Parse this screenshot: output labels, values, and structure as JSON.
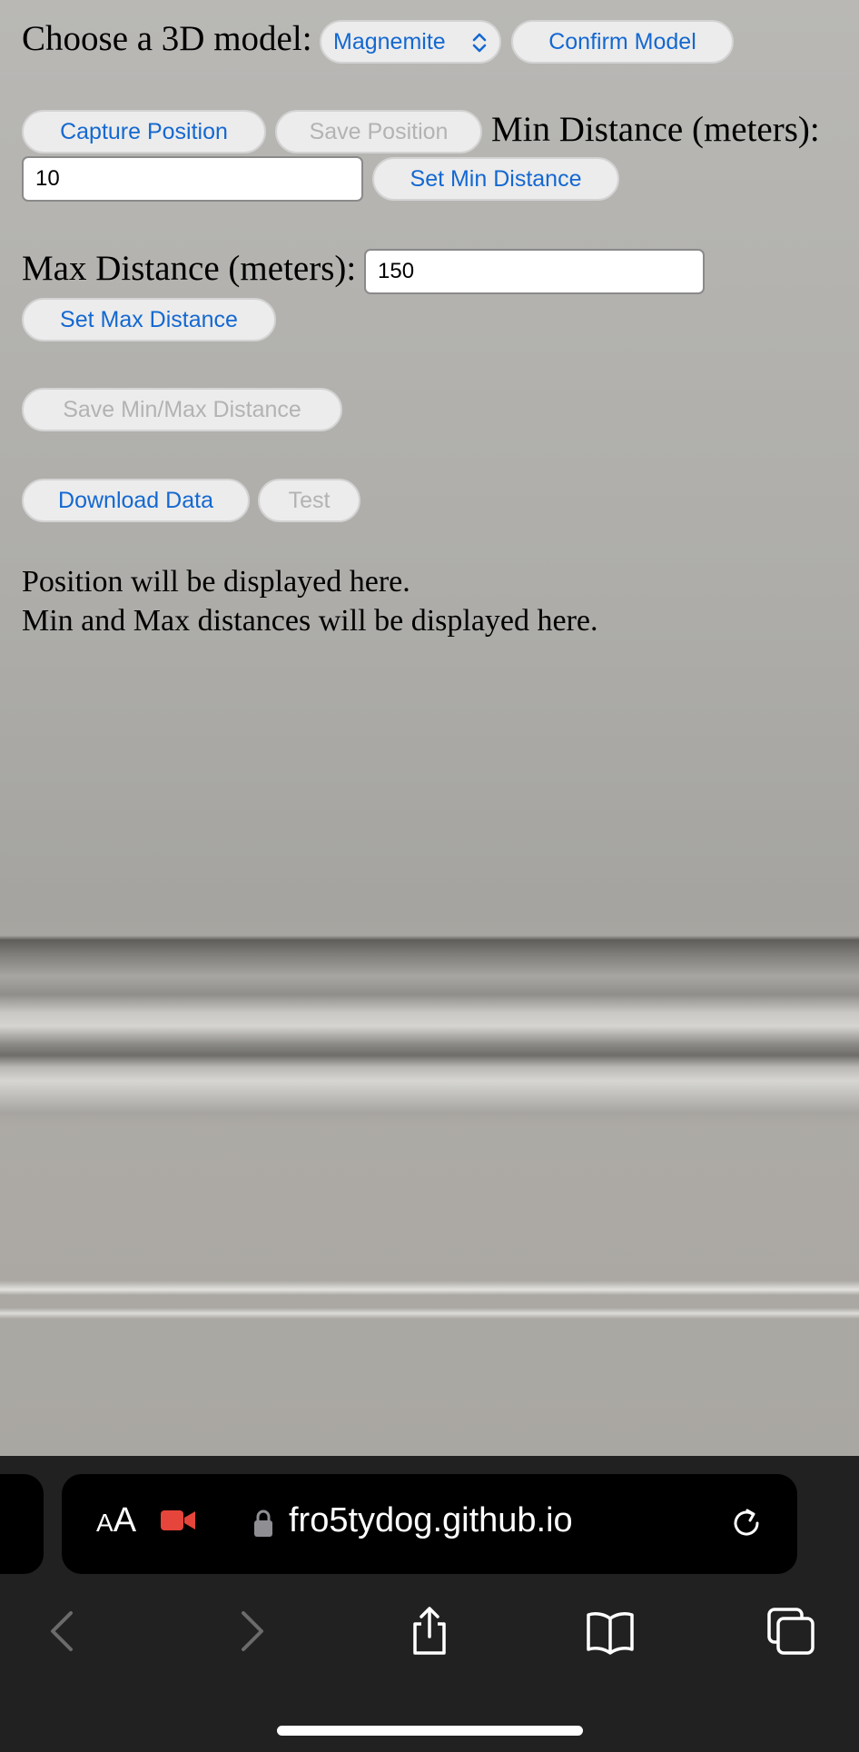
{
  "model_select": {
    "label": "Choose a 3D model:",
    "selected": "Magnemite",
    "confirm_label": "Confirm Model"
  },
  "position": {
    "capture_label": "Capture Position",
    "save_label": "Save Position"
  },
  "min_distance": {
    "label": "Min Distance (meters):",
    "value": "10",
    "set_label": "Set Min Distance"
  },
  "max_distance": {
    "label": "Max Distance (meters):",
    "value": "150",
    "set_label": "Set Max Distance"
  },
  "save_minmax_label": "Save Min/Max Distance",
  "download_label": "Download Data",
  "test_label": "Test",
  "info": {
    "position_text": "Position will be displayed here.",
    "distances_text": "Min and Max distances will be displayed here."
  },
  "browser": {
    "text_size_small": "A",
    "text_size_large": "A",
    "url": "fro5tydog.github.io",
    "recording_color": "#e5453a"
  }
}
